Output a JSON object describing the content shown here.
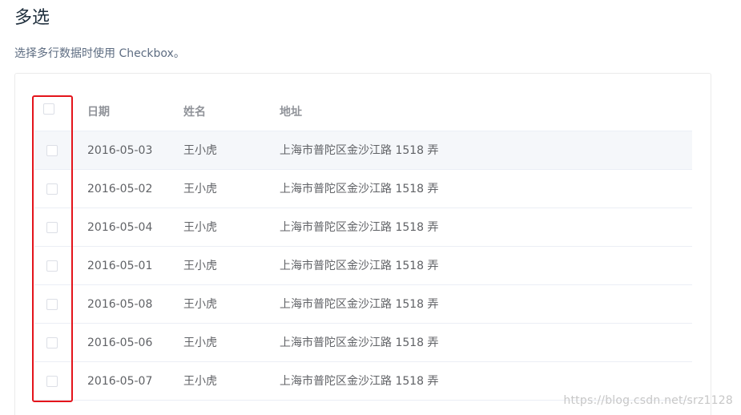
{
  "section": {
    "title": "多选",
    "description": "选择多行数据时使用 Checkbox。"
  },
  "table": {
    "headers": {
      "date": "日期",
      "name": "姓名",
      "address": "地址"
    },
    "rows": [
      {
        "date": "2016-05-03",
        "name": "王小虎",
        "address": "上海市普陀区金沙江路 1518 弄",
        "checked": false
      },
      {
        "date": "2016-05-02",
        "name": "王小虎",
        "address": "上海市普陀区金沙江路 1518 弄",
        "checked": false
      },
      {
        "date": "2016-05-04",
        "name": "王小虎",
        "address": "上海市普陀区金沙江路 1518 弄",
        "checked": false
      },
      {
        "date": "2016-05-01",
        "name": "王小虎",
        "address": "上海市普陀区金沙江路 1518 弄",
        "checked": false
      },
      {
        "date": "2016-05-08",
        "name": "王小虎",
        "address": "上海市普陀区金沙江路 1518 弄",
        "checked": false
      },
      {
        "date": "2016-05-06",
        "name": "王小虎",
        "address": "上海市普陀区金沙江路 1518 弄",
        "checked": false
      },
      {
        "date": "2016-05-07",
        "name": "王小虎",
        "address": "上海市普陀区金沙江路 1518 弄",
        "checked": false
      }
    ]
  },
  "annotation": {
    "highlight_color": "#e4141b"
  },
  "watermark": "https://blog.csdn.net/srz1128"
}
